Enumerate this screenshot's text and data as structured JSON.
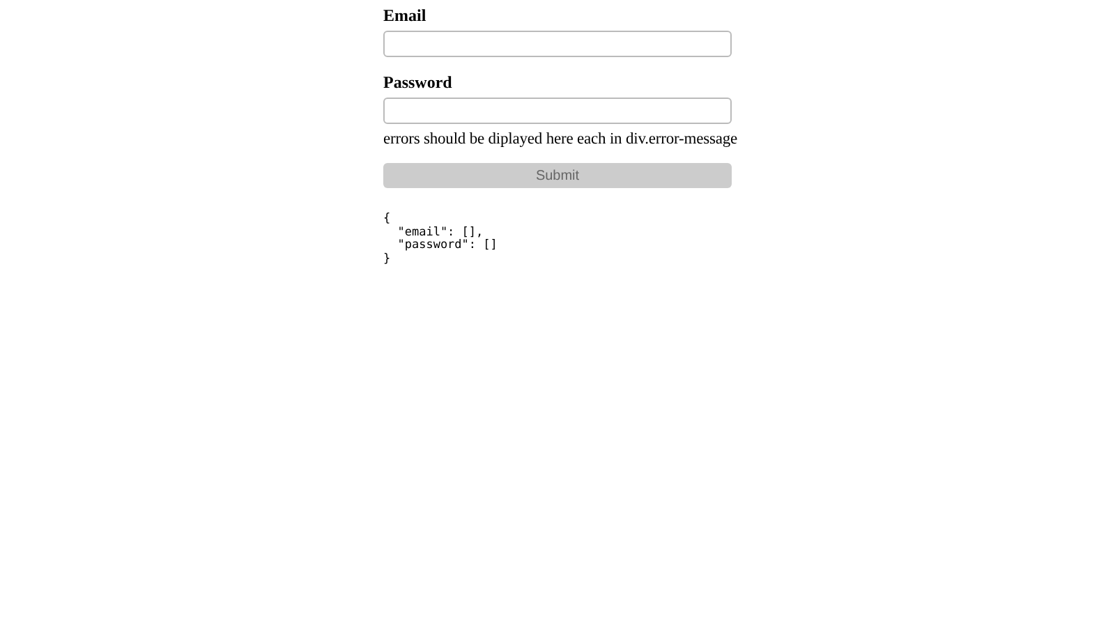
{
  "fields": [
    {
      "label": "Email"
    },
    {
      "label": "Password"
    }
  ],
  "error_note": "errors should be diplayed here each in div.error-message",
  "submit": {
    "label": "Submit",
    "disabled": true
  },
  "output": "{\n  \"email\": [],\n  \"password\": []\n}"
}
